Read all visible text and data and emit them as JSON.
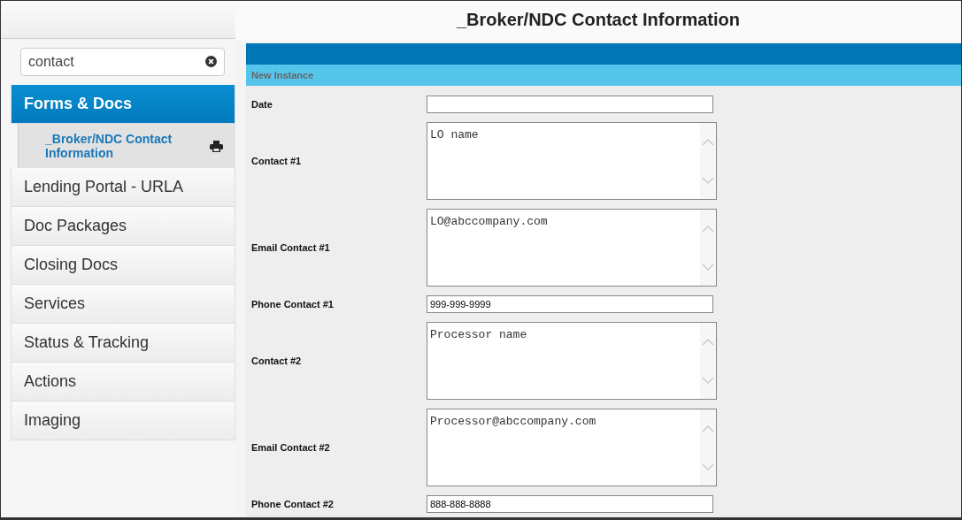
{
  "sidebar": {
    "search": {
      "value": "contact"
    },
    "items": [
      {
        "label": "Forms & Docs",
        "selected": true,
        "children": [
          {
            "label": "_Broker/NDC Contact Information"
          }
        ]
      },
      {
        "label": "Lending Portal - URLA",
        "selected": false
      },
      {
        "label": "Doc Packages",
        "selected": false
      },
      {
        "label": "Closing Docs",
        "selected": false
      },
      {
        "label": "Services",
        "selected": false
      },
      {
        "label": "Status & Tracking",
        "selected": false
      },
      {
        "label": "Actions",
        "selected": false
      },
      {
        "label": "Imaging",
        "selected": false
      }
    ]
  },
  "form": {
    "title": "_Broker/NDC Contact Information",
    "section": "New Instance",
    "fields": [
      {
        "label": "Date",
        "kind": "text"
      },
      {
        "label": "Contact #1",
        "kind": "textarea",
        "value": "LO name"
      },
      {
        "label": "Email Contact #1",
        "kind": "textarea",
        "value": "LO@abccompany.com"
      },
      {
        "label": "Phone Contact #1",
        "kind": "text",
        "value": "999-999-9999"
      },
      {
        "label": "Contact #2",
        "kind": "textarea",
        "value": "Processor name"
      },
      {
        "label": "Email Contact #2",
        "kind": "textarea",
        "value": "Processor@abccompany.com"
      },
      {
        "label": "Phone Contact #2",
        "kind": "text",
        "value": "888-888-8888"
      }
    ]
  }
}
